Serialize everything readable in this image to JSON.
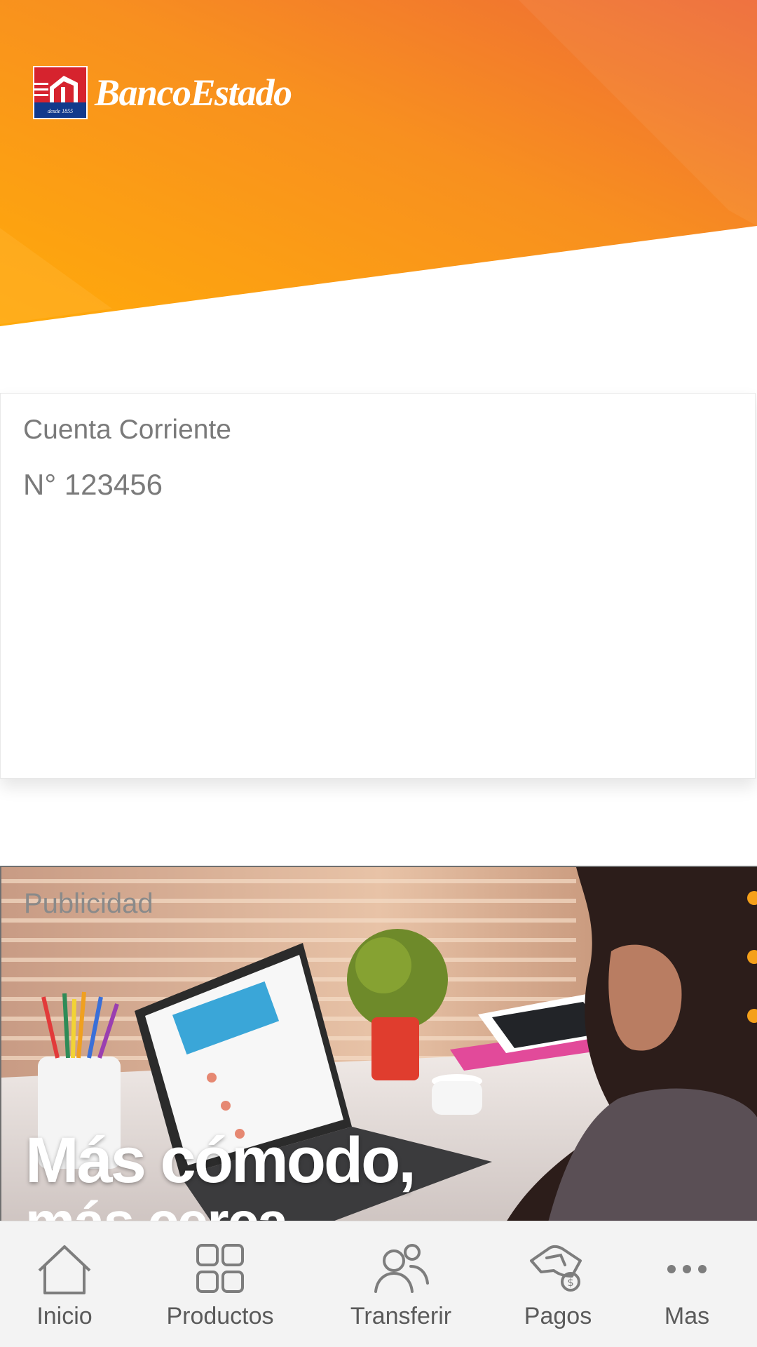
{
  "header": {
    "brand_name": "BancoEstado",
    "logo_caption": "desde 1855",
    "colors": {
      "gradient_start": "#ffa90c",
      "gradient_end": "#ef6b34"
    }
  },
  "account": {
    "type": "Cuenta Corriente",
    "number": "N° 123456"
  },
  "ad": {
    "label": "Publicidad",
    "headline": "Más cómodo,",
    "headline_cont": "más cerca"
  },
  "nav": {
    "items": [
      {
        "label": "Inicio",
        "icon": "home-icon"
      },
      {
        "label": "Productos",
        "icon": "grid-icon"
      },
      {
        "label": "Transferir",
        "icon": "users-icon"
      },
      {
        "label": "Pagos",
        "icon": "payment-hand-icon"
      },
      {
        "label": "Mas",
        "icon": "more-dots-icon"
      }
    ]
  }
}
